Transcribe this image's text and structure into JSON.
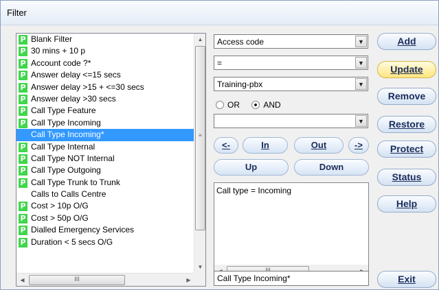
{
  "window": {
    "title": "Filter"
  },
  "filters": [
    {
      "label": "Blank Filter",
      "icon": "P"
    },
    {
      "label": "30 mins + 10 p",
      "icon": "P"
    },
    {
      "label": "Account code ?*",
      "icon": "P"
    },
    {
      "label": "Answer delay <=15 secs",
      "icon": "P"
    },
    {
      "label": "Answer delay >15 + <=30 secs",
      "icon": "P"
    },
    {
      "label": "Answer delay >30 secs",
      "icon": "P"
    },
    {
      "label": "Call Type Feature",
      "icon": "P"
    },
    {
      "label": "Call Type Incoming",
      "icon": "P"
    },
    {
      "label": "Call Type Incoming*",
      "icon": "",
      "selected": true
    },
    {
      "label": "Call Type Internal",
      "icon": "P"
    },
    {
      "label": "Call Type NOT Internal",
      "icon": "P"
    },
    {
      "label": "Call Type Outgoing",
      "icon": "P"
    },
    {
      "label": "Call Type Trunk to Trunk",
      "icon": "P"
    },
    {
      "label": "Calls to Calls Centre",
      "icon": ""
    },
    {
      "label": "Cost > 10p O/G",
      "icon": "P"
    },
    {
      "label": "Cost > 50p O/G",
      "icon": "P"
    },
    {
      "label": "Dialled Emergency Services",
      "icon": "P"
    },
    {
      "label": "Duration < 5 secs O/G",
      "icon": "P"
    }
  ],
  "editor": {
    "field_value": "Access code",
    "operator_value": "=",
    "value_value": "Training-pbx",
    "logic_or": "OR",
    "logic_and": "AND",
    "logic_selected": "AND",
    "extra_value": "",
    "btn_left": "<-",
    "btn_in": "In",
    "btn_out": "Out",
    "btn_right": "->",
    "btn_up": "Up",
    "btn_down": "Down",
    "expression": "Call type = Incoming",
    "filter_name": "Call Type Incoming*"
  },
  "buttons": {
    "add": "Add",
    "update": "Update",
    "remove": "Remove",
    "restore": "Restore",
    "protect": "Protect",
    "status": "Status",
    "help": "Help",
    "exit": "Exit"
  },
  "scroll": {
    "thumb_glyph": "III"
  },
  "colors": {
    "selected_bg": "#3399ff",
    "p_icon": "#3fd64a",
    "active_button": "#ffe680"
  }
}
